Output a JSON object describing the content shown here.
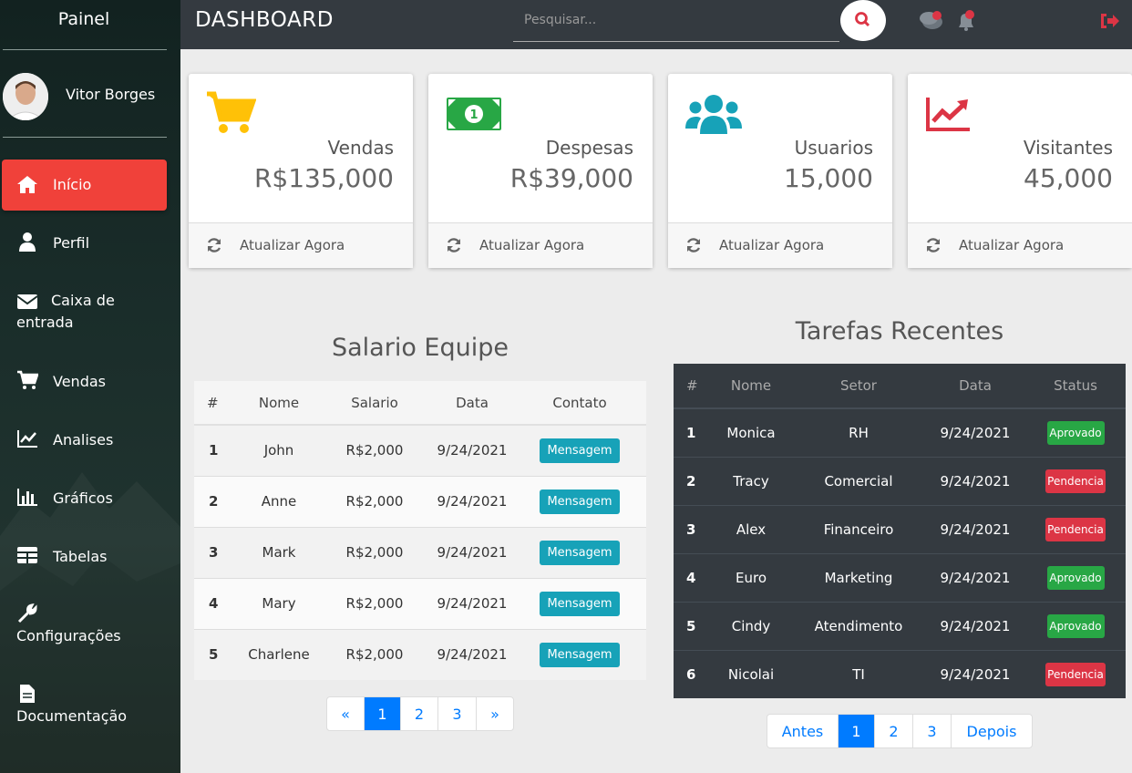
{
  "sidebar": {
    "title": "Painel",
    "user_name": "Vitor Borges",
    "items": [
      {
        "label": "Início",
        "icon": "home-icon"
      },
      {
        "label": "Perfil",
        "icon": "user-icon"
      },
      {
        "label": "Caixa de entrada",
        "icon": "envelope-icon"
      },
      {
        "label": "Vendas",
        "icon": "cart-icon"
      },
      {
        "label": "Analises",
        "icon": "line-chart-icon"
      },
      {
        "label": "Gráficos",
        "icon": "bar-chart-icon"
      },
      {
        "label": "Tabelas",
        "icon": "table-icon"
      },
      {
        "label": "Configurações",
        "icon": "wrench-icon"
      },
      {
        "label": "Documentação",
        "icon": "document-icon"
      }
    ]
  },
  "header": {
    "title": "DASHBOARD",
    "search_placeholder": "Pesquisar..."
  },
  "cards": [
    {
      "title": "Vendas",
      "value": "R$135,000",
      "footer": "Atualizar Agora",
      "icon": "cart-icon",
      "color": "#ffc107"
    },
    {
      "title": "Despesas",
      "value": "R$39,000",
      "footer": "Atualizar Agora",
      "icon": "money-icon",
      "color": "#28a745"
    },
    {
      "title": "Usuarios",
      "value": "15,000",
      "footer": "Atualizar Agora",
      "icon": "users-icon",
      "color": "#17a2b8"
    },
    {
      "title": "Visitantes",
      "value": "45,000",
      "footer": "Atualizar Agora",
      "icon": "line-chart-icon",
      "color": "#dc3545"
    }
  ],
  "salario": {
    "title": "Salario Equipe",
    "columns": [
      "#",
      "Nome",
      "Salario",
      "Data",
      "Contato"
    ],
    "rows": [
      {
        "num": "1",
        "nome": "John",
        "salario": "R$2,000",
        "data": "9/24/2021",
        "contato": "Mensagem"
      },
      {
        "num": "2",
        "nome": "Anne",
        "salario": "R$2,000",
        "data": "9/24/2021",
        "contato": "Mensagem"
      },
      {
        "num": "3",
        "nome": "Mark",
        "salario": "R$2,000",
        "data": "9/24/2021",
        "contato": "Mensagem"
      },
      {
        "num": "4",
        "nome": "Mary",
        "salario": "R$2,000",
        "data": "9/24/2021",
        "contato": "Mensagem"
      },
      {
        "num": "5",
        "nome": "Charlene",
        "salario": "R$2,000",
        "data": "9/24/2021",
        "contato": "Mensagem"
      }
    ],
    "pagination": [
      "«",
      "1",
      "2",
      "3",
      "»"
    ]
  },
  "tarefas": {
    "title": "Tarefas Recentes",
    "columns": [
      "#",
      "Nome",
      "Setor",
      "Data",
      "Status"
    ],
    "rows": [
      {
        "num": "1",
        "nome": "Monica",
        "setor": "RH",
        "data": "9/24/2021",
        "status": "Aprovado"
      },
      {
        "num": "2",
        "nome": "Tracy",
        "setor": "Comercial",
        "data": "9/24/2021",
        "status": "Pendencia"
      },
      {
        "num": "3",
        "nome": "Alex",
        "setor": "Financeiro",
        "data": "9/24/2021",
        "status": "Pendencia"
      },
      {
        "num": "4",
        "nome": "Euro",
        "setor": "Marketing",
        "data": "9/24/2021",
        "status": "Aprovado"
      },
      {
        "num": "5",
        "nome": "Cindy",
        "setor": "Atendimento",
        "data": "9/24/2021",
        "status": "Aprovado"
      },
      {
        "num": "6",
        "nome": "Nicolai",
        "setor": "TI",
        "data": "9/24/2021",
        "status": "Pendencia"
      }
    ],
    "pagination": [
      "Antes",
      "1",
      "2",
      "3",
      "Depois"
    ]
  },
  "colors": {
    "sidebar_active": "#f0413a",
    "topbar": "#343a40",
    "link": "#007bff",
    "approved": "#28a745",
    "pending": "#dc3545"
  }
}
